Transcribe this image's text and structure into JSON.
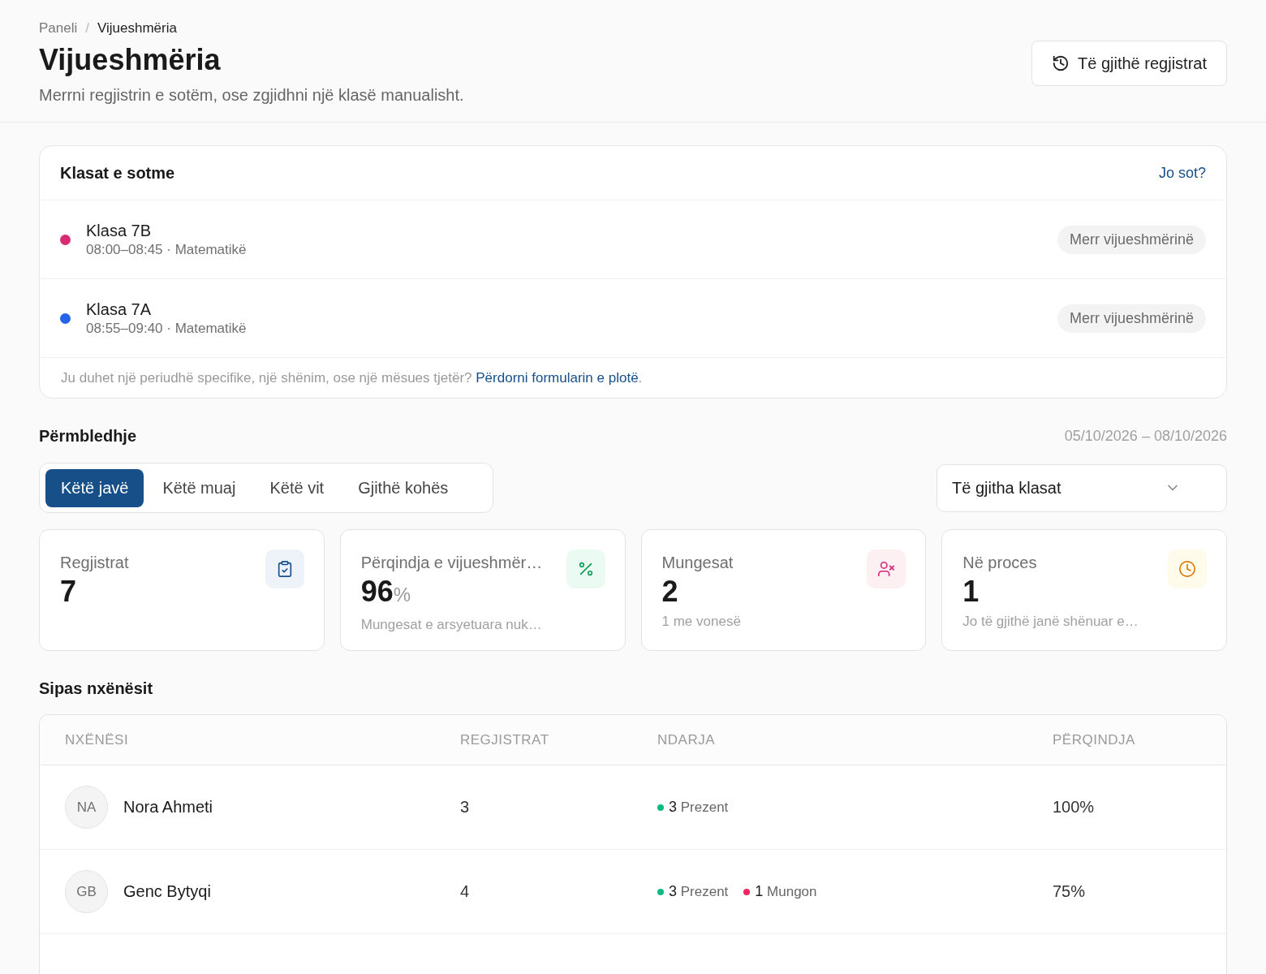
{
  "breadcrumb": {
    "separator": "/",
    "items": [
      {
        "label": "Paneli",
        "current": false
      },
      {
        "label": "Vijueshmëria",
        "current": true
      }
    ]
  },
  "page": {
    "title": "Vijueshmëria",
    "subtitle": "Merrni regjistrin e sotëm, ose zgjidhni një klasë manualisht.",
    "button": "Të gjithë regjistrat"
  },
  "today": {
    "title": "Klasat e sotme",
    "link": "Jo sot?",
    "classes": [
      {
        "name": "Klasa 7B",
        "detail": "08:00–08:45 · Matematikë",
        "color": "#d92a72",
        "action": "Merr vijueshmërinë"
      },
      {
        "name": "Klasa 7A",
        "detail": "08:55–09:40 · Matematikë",
        "color": "#2563eb",
        "action": "Merr vijueshmërinë"
      }
    ],
    "footer": {
      "text": "Ju duhet një periudhë specifike, një shënim, ose një mësues tjetër?",
      "link": "Përdorni formularin e plotë",
      "end": "."
    }
  },
  "summary": {
    "title": "Përmbledhje",
    "date_range": "05/10/2026 – 08/10/2026",
    "tabs": [
      {
        "label": "Këtë javë",
        "selected": true
      },
      {
        "label": "Këtë muaj",
        "selected": false
      },
      {
        "label": "Këtë vit",
        "selected": false
      },
      {
        "label": "Gjithë kohës",
        "selected": false
      }
    ],
    "class_select": {
      "value": "Të gjitha klasat"
    },
    "stats": [
      {
        "kind": "records",
        "label": "Regjistrat",
        "value": "7"
      },
      {
        "kind": "rate",
        "label": "Përqindja e vijueshmër…",
        "value": "96",
        "unit": "%",
        "note": "Mungesat e arsyetuara nuk…"
      },
      {
        "kind": "absences",
        "label": "Mungesat",
        "value": "2",
        "note": "1 me vonesë"
      },
      {
        "kind": "pending",
        "label": "Në proces",
        "value": "1",
        "note": "Jo të gjithë janë shënuar e…"
      }
    ]
  },
  "students": {
    "title": "Sipas nxënësit",
    "columns": [
      "NXËNËSI",
      "REGJISTRAT",
      "NDARJA",
      "PËRQINDJA"
    ],
    "rows": [
      {
        "initials": "NA",
        "name": "Nora Ahmeti",
        "records": "3",
        "breakdown": [
          {
            "count": "3",
            "label": "Prezent",
            "color": "#10b981"
          }
        ],
        "percent": "100%"
      },
      {
        "initials": "GB",
        "name": "Genc Bytyqi",
        "records": "4",
        "breakdown": [
          {
            "count": "3",
            "label": "Prezent",
            "color": "#10b981"
          },
          {
            "count": "1",
            "label": "Mungon",
            "color": "#f0255f"
          }
        ],
        "percent": "75%"
      }
    ]
  }
}
